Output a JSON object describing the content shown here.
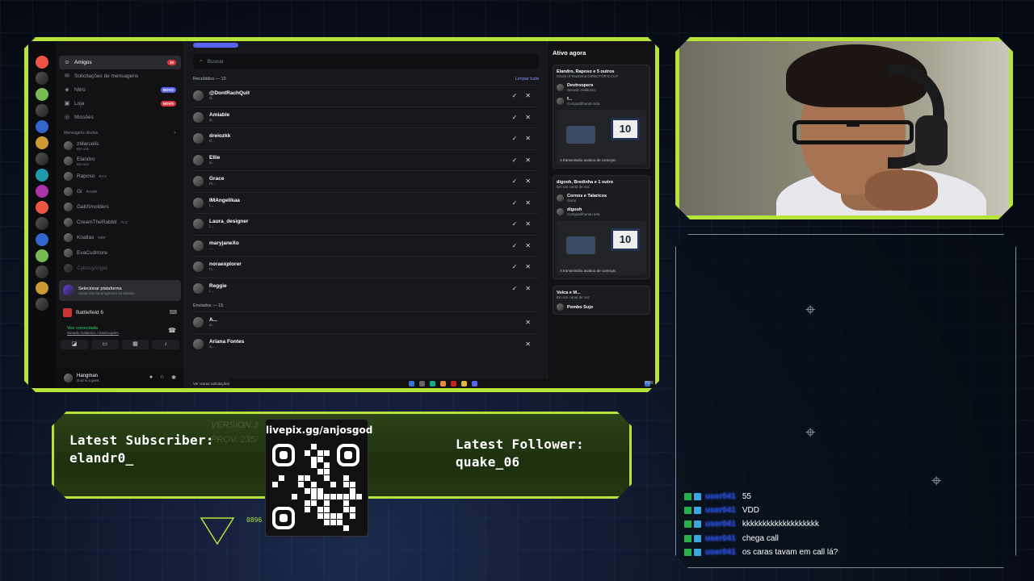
{
  "discord": {
    "nav": [
      {
        "icon": "friends-icon",
        "label": "Amigos",
        "badge": "10",
        "active": true
      },
      {
        "icon": "requests-icon",
        "label": "Solicitações de mensagens",
        "badge": ""
      },
      {
        "icon": "nitro-icon",
        "label": "Nitro",
        "badge": "NOVO"
      },
      {
        "icon": "store-icon",
        "label": "Loja",
        "badge": "NOVO"
      },
      {
        "icon": "missions-icon",
        "label": "Missões",
        "badge": ""
      }
    ],
    "dm_header": "Mensagens diretas",
    "dm_add": "+",
    "dms": [
      {
        "name": "zMarcelis",
        "sub": "Em voz"
      },
      {
        "name": "Elandro",
        "sub": "Em voz"
      },
      {
        "name": "Raposo",
        "sub": "RYU"
      },
      {
        "name": "Gi",
        "sub": "RAWR"
      },
      {
        "name": "GabSmolders",
        "sub": ""
      },
      {
        "name": "CreamTheRabbit",
        "sub": "TLC"
      },
      {
        "name": "Koallas",
        "sub": "NRP"
      },
      {
        "name": "EvaCudmore",
        "sub": ""
      },
      {
        "name": "CyborgAngel",
        "sub": ""
      }
    ],
    "platform": {
      "title": "Selecionar plataforma",
      "sub": "Ainda não há progresso na Missão"
    },
    "game": "Battlefield 6",
    "voice": {
      "status": "Voz conectada",
      "channel": "Senado Galáctico / Devtroopers"
    },
    "user": {
      "name": "Hangman",
      "status": "God is a geek"
    },
    "search_placeholder": "Buscar",
    "received_header": "Recebidos — 10",
    "clear_all": "Limpar tudo",
    "received": [
      {
        "name": "@DontRachQuit",
        "sub": "d..."
      },
      {
        "name": "Amiable",
        "sub": "a..."
      },
      {
        "name": "dreiozkk",
        "sub": "d..."
      },
      {
        "name": "Ellie",
        "sub": "a..."
      },
      {
        "name": "Grace",
        "sub": "m..."
      },
      {
        "name": "IMAngelikaa",
        "sub": "i..."
      },
      {
        "name": "Laura_designer",
        "sub": "l..."
      },
      {
        "name": "maryjaneXo",
        "sub": "..."
      },
      {
        "name": "noraexplorer",
        "sub": "n..."
      },
      {
        "name": "Reggie",
        "sub": "i..."
      }
    ],
    "sent_header": "Enviados — 15",
    "sent": [
      {
        "name": "A...",
        "sub": "a..."
      },
      {
        "name": "Ariana Fontes",
        "sub": "a..."
      }
    ],
    "more_requests": "Ver outras solicitações",
    "taskbar_lang": "POR",
    "active_now": {
      "title": "Ativo agora",
      "cards": [
        {
          "title": "Elandro, Raposo e 5 outros",
          "sub": "Ghost of Tsushima DIRECTOR'S CUT",
          "lines": [
            {
              "name": "Devtroopers",
              "sub": "Senado Galáctico"
            },
            {
              "name": "f...",
              "sub": "Compartilhando tela"
            }
          ],
          "stream_caption": "A transmissão acabou de começar.",
          "tv": "10"
        },
        {
          "title": "digooh, Bredinha e 1 outro",
          "sub": "Em um canal de voz",
          "lines": [
            {
              "name": "Cornos e Talaricos",
              "sub": "Geral"
            },
            {
              "name": "digooh",
              "sub": "Compartilhando tela"
            }
          ],
          "stream_caption": "A transmissão acabou de começar.",
          "tv": "10"
        },
        {
          "title": "Volca e M...",
          "sub": "Em um canal de voz",
          "lines": [
            {
              "name": "Pombo Sujo",
              "sub": ""
            }
          ],
          "stream_caption": "",
          "tv": ""
        }
      ]
    }
  },
  "overlay": {
    "latest_subscriber_label": "Latest Subscriber:",
    "latest_subscriber": "elandr0_",
    "latest_follower_label": "Latest Follower:",
    "latest_follower": "quake_06",
    "qr_url": "livepix.gg/anjosgod",
    "bg_text_1": "VERSION.3",
    "bg_text_2": "PROV. 235/",
    "code": "0896"
  },
  "chat": [
    {
      "user": "user041",
      "text": "55"
    },
    {
      "user": "user041",
      "text": "VDD"
    },
    {
      "user": "user041",
      "text": "kkkkkkkkkkkkkkkkkkk"
    },
    {
      "user": "user041",
      "text": "chega call"
    },
    {
      "user": "user041",
      "text": "os caras tavam em call lá?"
    }
  ],
  "colors": {
    "accent": "#b6e33a",
    "discord_blurple": "#5865f2",
    "danger": "#da373c"
  }
}
